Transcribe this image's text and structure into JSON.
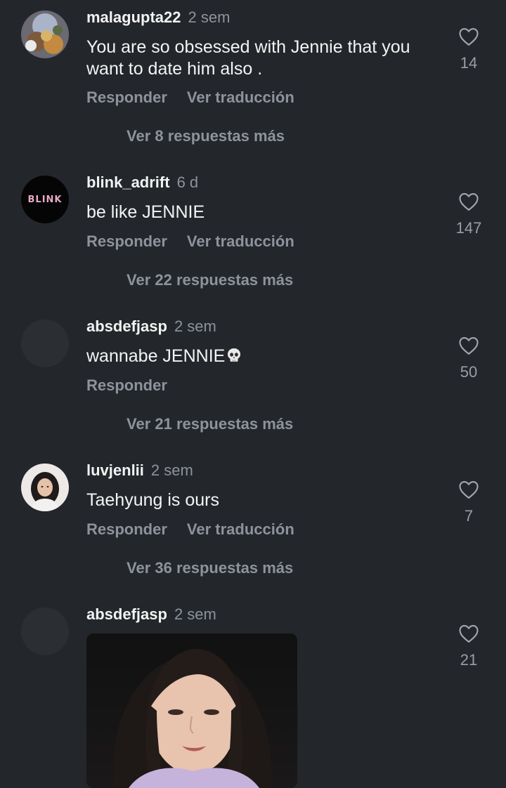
{
  "comments": [
    {
      "username": "malagupta22",
      "time": "2 sem",
      "text": "You are so obsessed with Jennie that you want to date him also .",
      "reply": "Responder",
      "translate": "Ver traducción",
      "more_replies": "Ver 8 respuestas más",
      "likes": "14"
    },
    {
      "username": "blink_adrift",
      "time": "6 d",
      "avatar_text": "BLINK",
      "text": "be like JENNIE",
      "reply": "Responder",
      "translate": "Ver traducción",
      "more_replies": "Ver 22 respuestas más",
      "likes": "147"
    },
    {
      "username": "absdefjasp",
      "time": "2 sem",
      "text": "wannabe JENNIE",
      "emoji": "skull-emoji",
      "reply": "Responder",
      "more_replies": "Ver 21 respuestas más",
      "likes": "50"
    },
    {
      "username": "luvjenlii",
      "time": "2 sem",
      "text": "Taehyung is ours",
      "reply": "Responder",
      "translate": "Ver traducción",
      "more_replies": "Ver 36 respuestas más",
      "likes": "7"
    },
    {
      "username": "absdefjasp",
      "time": "2 sem",
      "attachment": "photo",
      "likes": "21"
    }
  ],
  "icons": {
    "like": "heart-outline-icon"
  },
  "colors": {
    "background": "#23262b",
    "text": "#f2f2f2",
    "secondary": "#8e939b"
  }
}
